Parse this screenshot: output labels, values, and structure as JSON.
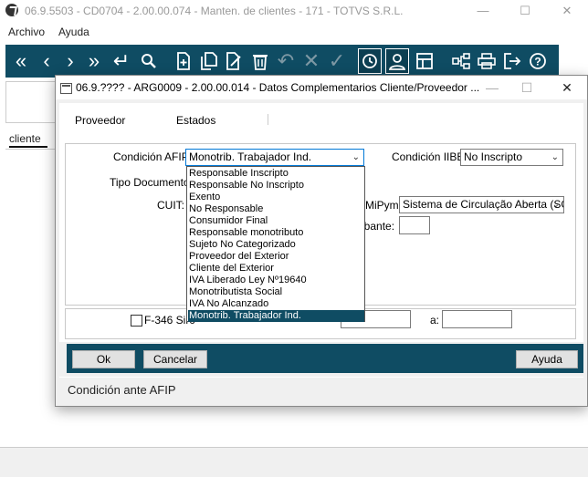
{
  "main_window": {
    "title": "06.9.5503 - CD0704 - 2.00.00.074 - Manten. de clientes - 171 - TOTVS S.R.L.",
    "menu": [
      {
        "label": "Archivo"
      },
      {
        "label": "Ayuda"
      }
    ],
    "toolbar_icons": [
      "first-icon",
      "prev-icon",
      "next-icon",
      "last-icon",
      "enter-icon",
      "search-icon",
      "new-doc-icon",
      "copy-doc-icon",
      "edit-doc-icon",
      "delete-icon",
      "undo-icon",
      "cancel-icon",
      "confirm-icon",
      "history-icon",
      "user-icon",
      "layout-icon",
      "tree-icon",
      "print-icon",
      "exit-icon",
      "help-icon"
    ],
    "tab_label": "cliente"
  },
  "dialog": {
    "title": "06.9.???? - ARG0009 - 2.00.00.014 - Datos Complementarios Cliente/Proveedor ...",
    "tabs": [
      {
        "label": "Proveedor",
        "active": true
      },
      {
        "label": "Estados",
        "active": false
      }
    ],
    "fields": {
      "condicion_afip_label": "Condición AFIP:",
      "condicion_afip_value": "Monotrib. Trabajador Ind.",
      "condicion_iibb_label": "Condición IIBB:",
      "condicion_iibb_value": "No Inscripto",
      "tipo_documento_label": "Tipo Documento:",
      "cuit_label": "CUIT:",
      "mipyme_label": "MiPyme:",
      "mipyme_value": "Sistema de Circulação Aberta (SC",
      "comprobante_label": "robante:",
      "f346_label": "F-346 Sirc",
      "a_label": "a:"
    },
    "dropdown_options": [
      "Responsable Inscripto",
      "Responsable No Inscripto",
      "Exento",
      "No Responsable",
      "Consumidor Final",
      "Responsable monotributo",
      "Sujeto No Categorizado",
      "Proveedor del Exterior",
      "Cliente del Exterior",
      "IVA Liberado Ley Nº19640",
      "Monotributista Social",
      "IVA No Alcanzado",
      "Monotrib. Trabajador Ind."
    ],
    "selected_option_index": 12,
    "buttons": {
      "ok": "Ok",
      "cancel": "Cancelar",
      "help": "Ayuda"
    },
    "status_text": "Condición ante AFIP"
  },
  "colors": {
    "toolbar_bg": "#0f4c63",
    "selection_bg": "#0f4c63",
    "dialog_bg": "#f0f0f0"
  }
}
